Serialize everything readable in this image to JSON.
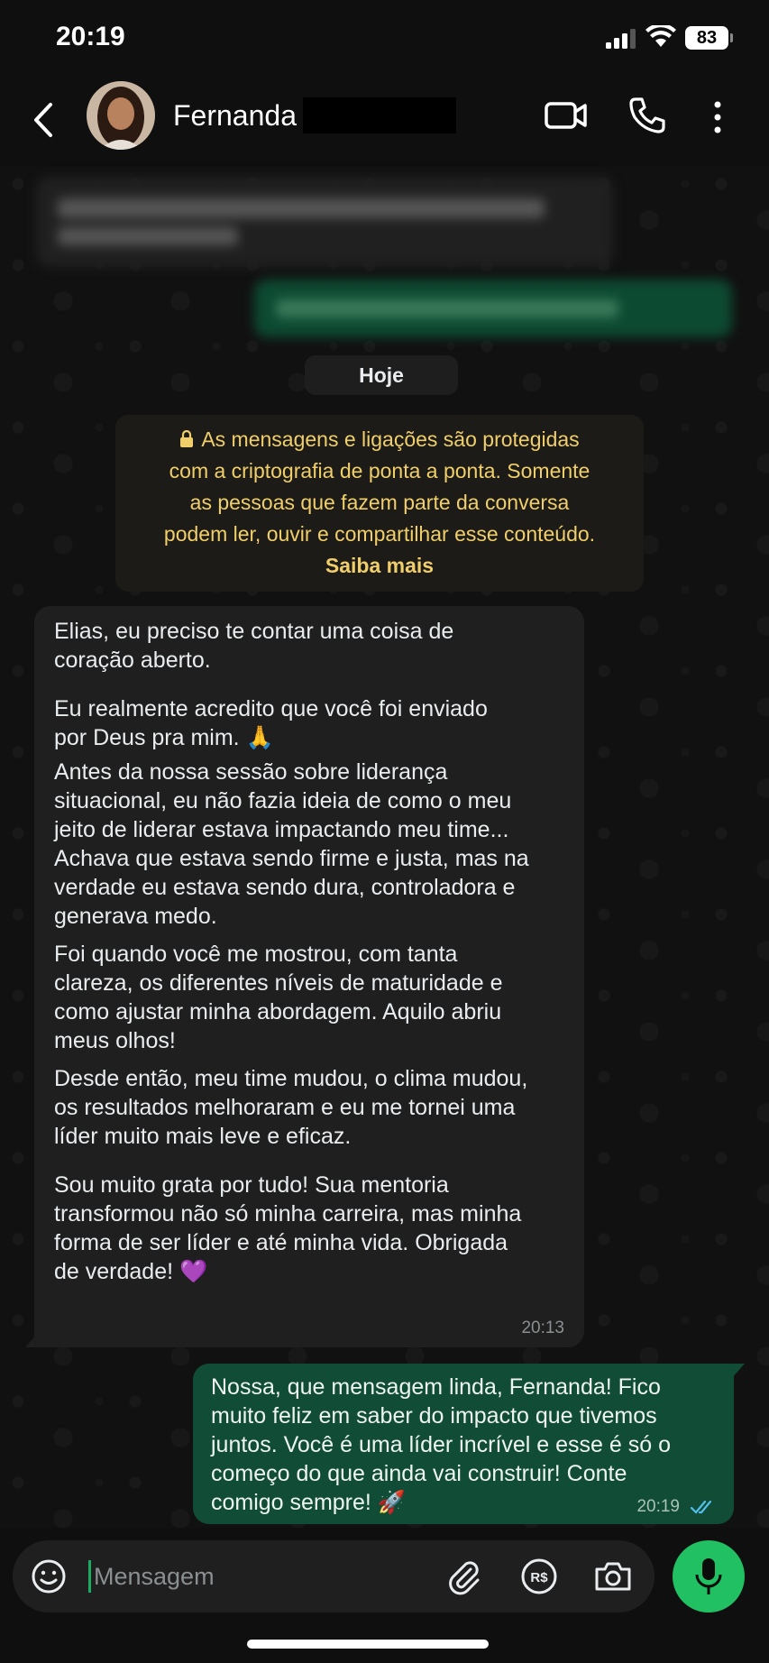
{
  "status_bar": {
    "time": "20:19",
    "battery": "83"
  },
  "header": {
    "contact_name": "Fernanda"
  },
  "chat": {
    "date_label": "Hoje",
    "encryption_notice": {
      "lines": [
        "As mensagens e ligações são protegidas",
        "com a criptografia de ponta a ponta. Somente",
        "as pessoas que fazem parte da conversa",
        "podem ler, ouvir e compartilhar esse conteúdo."
      ],
      "link": "Saiba mais"
    },
    "incoming_message": {
      "lines": [
        "Elias, eu preciso te contar uma coisa de",
        "coração aberto.",
        "",
        "Eu realmente acredito que você foi enviado",
        "por Deus pra mim. 🙏",
        "Antes da nossa sessão sobre liderança",
        "situacional, eu não fazia ideia de como o meu",
        "jeito de liderar estava impactando meu time...",
        "Achava que estava sendo firme e justa, mas na",
        "verdade eu estava sendo dura, controladora e",
        "generava medo.",
        "Foi quando você me mostrou, com tanta",
        "clareza, os diferentes níveis de maturidade e",
        "como ajustar minha abordagem. Aquilo abriu",
        "meus olhos!",
        "Desde então, meu time mudou, o clima mudou,",
        "os resultados melhoraram e eu me tornei uma",
        "líder muito mais leve e eficaz.",
        "",
        "Sou muito grata por tudo! Sua mentoria",
        "transformou não só minha carreira, mas minha",
        "forma de ser líder e até minha vida. Obrigada",
        "de verdade!  💜"
      ],
      "time": "20:13"
    },
    "outgoing_message": {
      "lines": [
        "Nossa, que mensagem linda, Fernanda! Fico",
        "muito feliz em saber do impacto que tivemos",
        "juntos. Você é uma líder incrível e esse é só o",
        "começo do que ainda vai construir! Conte",
        "comigo sempre! 🚀"
      ],
      "time": "20:19",
      "status": "read"
    }
  },
  "composer": {
    "placeholder": "Mensagem"
  },
  "colors": {
    "outgoing_bubble": "#114d36",
    "incoming_bubble": "#1f1f1f",
    "accent_green": "#21c063",
    "notice_text": "#f0cf6a",
    "read_ticks": "#53bdeb"
  },
  "icons": [
    "back-icon",
    "video-call-icon",
    "voice-call-icon",
    "menu-icon",
    "lock-icon",
    "emoji-icon",
    "attach-icon",
    "pix-icon",
    "camera-icon",
    "mic-icon",
    "read-ticks-icon"
  ]
}
